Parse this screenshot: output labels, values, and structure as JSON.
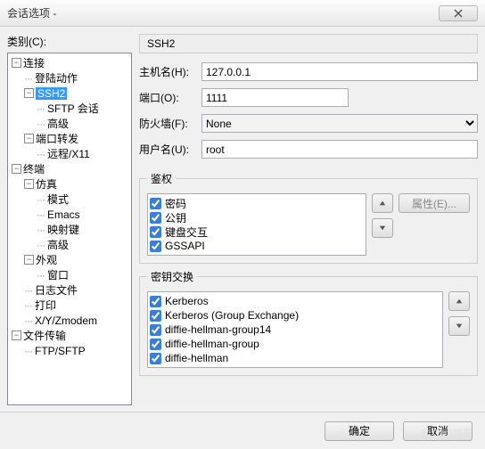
{
  "window": {
    "title": "会话选项 -"
  },
  "category_label": "类别(C):",
  "tree": [
    {
      "label": "连接",
      "expand": "-",
      "indent": 0
    },
    {
      "label": "登陆动作",
      "expand": "",
      "indent": 1,
      "dots": true
    },
    {
      "label": "SSH2",
      "expand": "-",
      "indent": 1,
      "selected": true
    },
    {
      "label": "SFTP 会话",
      "expand": "",
      "indent": 2,
      "dots": true
    },
    {
      "label": "高级",
      "expand": "",
      "indent": 2,
      "dots": true
    },
    {
      "label": "端口转发",
      "expand": "-",
      "indent": 1
    },
    {
      "label": "远程/X11",
      "expand": "",
      "indent": 2,
      "dots": true
    },
    {
      "label": "终端",
      "expand": "-",
      "indent": 0
    },
    {
      "label": "仿真",
      "expand": "-",
      "indent": 1
    },
    {
      "label": "模式",
      "expand": "",
      "indent": 2,
      "dots": true
    },
    {
      "label": "Emacs",
      "expand": "",
      "indent": 2,
      "dots": true
    },
    {
      "label": "映射键",
      "expand": "",
      "indent": 2,
      "dots": true
    },
    {
      "label": "高级",
      "expand": "",
      "indent": 2,
      "dots": true
    },
    {
      "label": "外观",
      "expand": "-",
      "indent": 1
    },
    {
      "label": "窗口",
      "expand": "",
      "indent": 2,
      "dots": true
    },
    {
      "label": "日志文件",
      "expand": "",
      "indent": 1,
      "dots": true
    },
    {
      "label": "打印",
      "expand": "",
      "indent": 1,
      "dots": true
    },
    {
      "label": "X/Y/Zmodem",
      "expand": "",
      "indent": 1,
      "dots": true
    },
    {
      "label": "文件传输",
      "expand": "-",
      "indent": 0
    },
    {
      "label": "FTP/SFTP",
      "expand": "",
      "indent": 1,
      "dots": true
    }
  ],
  "section_header": "SSH2",
  "fields": {
    "hostname": {
      "label": "主机名(H):",
      "value": "127.0.0.1"
    },
    "port": {
      "label": "端口(O):",
      "value": "1111"
    },
    "firewall": {
      "label": "防火墙(F):",
      "value": "None"
    },
    "username": {
      "label": "用户名(U):",
      "value": "root"
    }
  },
  "auth_group": {
    "legend": "鉴权",
    "items": [
      {
        "label": "密码",
        "checked": true
      },
      {
        "label": "公钥",
        "checked": true
      },
      {
        "label": "键盘交互",
        "checked": true
      },
      {
        "label": "GSSAPI",
        "checked": true
      }
    ],
    "properties_btn": "属性(E)..."
  },
  "kex_group": {
    "legend": "密钥交换",
    "items": [
      {
        "label": "Kerberos",
        "checked": true
      },
      {
        "label": "Kerberos (Group Exchange)",
        "checked": true
      },
      {
        "label": "diffie-hellman-group14",
        "checked": true
      },
      {
        "label": "diffie-hellman-group",
        "checked": true
      },
      {
        "label": "diffie-hellman",
        "checked": true
      }
    ]
  },
  "footer": {
    "ok": "确定",
    "cancel": "取消"
  },
  "watermark": "51CTO博客"
}
